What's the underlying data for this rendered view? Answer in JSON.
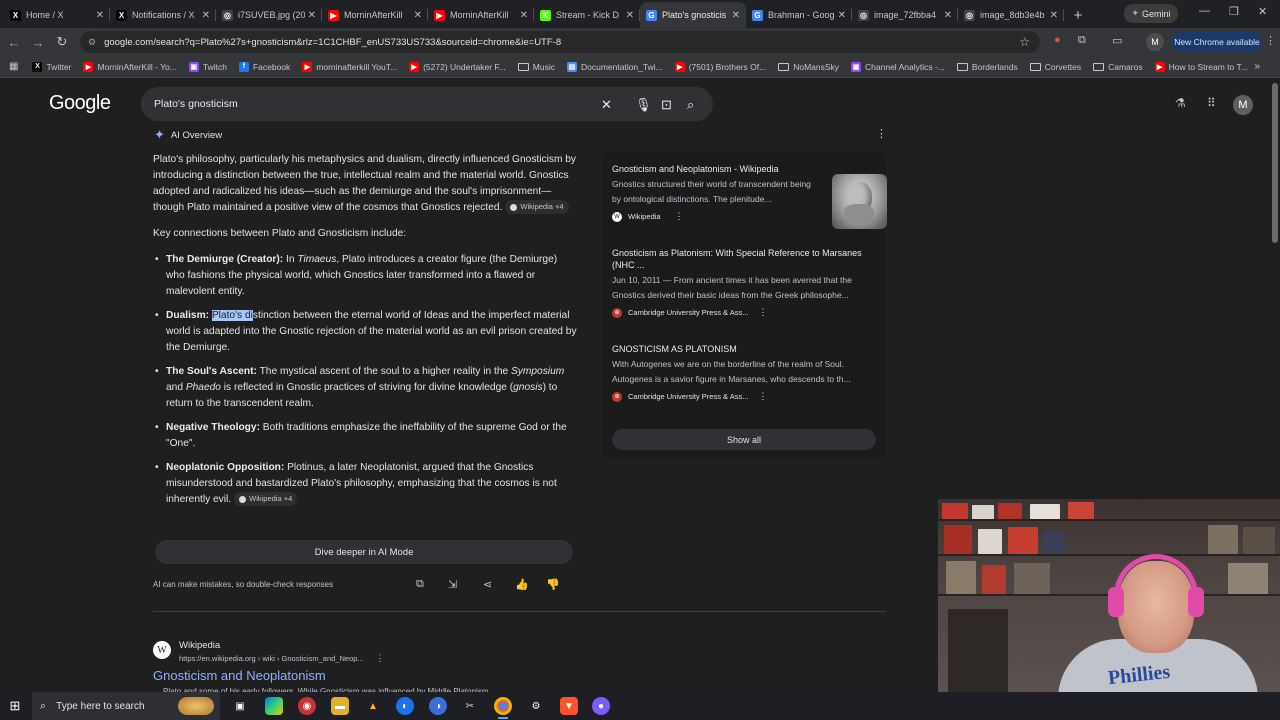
{
  "tabs": [
    {
      "title": "Home / X",
      "fav": "X",
      "color": "#000000"
    },
    {
      "title": "Notifications / X",
      "fav": "X",
      "color": "#000000"
    },
    {
      "title": "i7SUVEB.jpg (20",
      "fav": "◎",
      "color": "#444444"
    },
    {
      "title": "MorninAfterKill",
      "fav": "▶",
      "color": "#ff0000"
    },
    {
      "title": "MorninAfterKill",
      "fav": "▶",
      "color": "#ff0000"
    },
    {
      "title": "Stream - Kick D",
      "fav": "K",
      "color": "#53fc18"
    },
    {
      "title": "Plato's gnosticis",
      "fav": "G",
      "color": "#4285f4",
      "active": true
    },
    {
      "title": "Brahman - Goog",
      "fav": "G",
      "color": "#4285f4"
    },
    {
      "title": "image_72fbba4",
      "fav": "◎",
      "color": "#444444"
    },
    {
      "title": "image_8db3e4b",
      "fav": "◎",
      "color": "#444444"
    }
  ],
  "browser": {
    "gemini": "Gemini",
    "url": "google.com/search?q=Plato%27s+gnosticism&rlz=1C1CHBF_enUS733US733&sourceid=chrome&ie=UTF-8",
    "new_chrome": "New Chrome available",
    "profile_letter": "M"
  },
  "bookmarks": [
    {
      "label": "Twitter",
      "kind": "x"
    },
    {
      "label": "MorninAfterKill - Yo...",
      "kind": "yt"
    },
    {
      "label": "Twitch",
      "kind": "tw"
    },
    {
      "label": "Facebook",
      "kind": "fb"
    },
    {
      "label": "morninafterkill YouT...",
      "kind": "yt"
    },
    {
      "label": "(5272) Undertaker F...",
      "kind": "yt"
    },
    {
      "label": "Music",
      "kind": "folder"
    },
    {
      "label": "Documentation_Twi...",
      "kind": "doc"
    },
    {
      "label": "(7501) Brothers Of...",
      "kind": "yt"
    },
    {
      "label": "NoMansSky",
      "kind": "folder"
    },
    {
      "label": "Channel Analytics -...",
      "kind": "tw"
    },
    {
      "label": "Borderlands",
      "kind": "folder"
    },
    {
      "label": "Corvettes",
      "kind": "folder"
    },
    {
      "label": "Camaros",
      "kind": "folder"
    },
    {
      "label": "How to Stream to T...",
      "kind": "yt"
    }
  ],
  "google": {
    "logo": "Google",
    "query": "Plato's gnosticism",
    "avatar": "M"
  },
  "aio": {
    "header": "AI Overview",
    "para1": "Plato's philosophy, particularly his metaphysics and dualism, directly influenced Gnosticism by introducing a distinction between the true, intellectual realm and the material world. Gnostics adopted and radicalized his ideas—such as the demiurge and the soul's imprisonment—though Plato maintained a positive view of the cosmos that Gnostics rejected.",
    "cite": "Wikipedia +4",
    "intro": "Key connections between Plato and Gnosticism include:",
    "b1_title": "The Demiurge (Creator):",
    "b1_a": " In ",
    "b1_em": "Timaeus",
    "b1_b": ", Plato introduces a creator figure (the Demiurge) who fashions the physical world, which Gnostics later transformed into a flawed or malevolent entity.",
    "b2_title": "Dualism:",
    "b2_hl": "Plato's di",
    "b2_rest": "stinction between the eternal world of Ideas and the imperfect material world is adapted into the Gnostic rejection of the material world as an evil prison created by the Demiurge.",
    "b3_title": "The Soul's Ascent:",
    "b3_a": " The mystical ascent of the soul to a higher reality in the ",
    "b3_em1": "Symposium",
    "b3_b": " and ",
    "b3_em2": "Phaedo",
    "b3_c": " is reflected in Gnostic practices of striving for divine knowledge (",
    "b3_em3": "gnosis",
    "b3_d": ") to return to the transcendent realm.",
    "b4_title": "Negative Theology:",
    "b4_text": " Both traditions emphasize the ineffability of the supreme God or the \"One\".",
    "b5_title": "Neoplatonic Opposition:",
    "b5_text": " Plotinus, a later Neoplatonist, argued that the Gnostics misunderstood and bastardized Plato's philosophy, emphasizing that the cosmos is not inherently evil.",
    "cite2": "Wikipedia +4",
    "deeper": "Dive deeper in AI Mode",
    "disclaimer": "AI can make mistakes, so double-check responses"
  },
  "sources": [
    {
      "title": "Gnosticism and Neoplatonism - Wikipedia",
      "snippet": "Gnostics structured their world of transcendent being by ontological distinctions. The plenitude...",
      "publisher": "Wikipedia"
    },
    {
      "title": "Gnosticism as Platonism: With Special Reference to Marsanes (NHC ...",
      "snippet": "Jun 10, 2011 — From ancient times it has been averred that the Gnostics derived their basic ideas from the Greek philosophe...",
      "publisher": "Cambridge University Press & Ass..."
    },
    {
      "title": "GNOSTICISM AS PLATONISM",
      "snippet": "With Autogenes we are on the borderline of the realm of Soul. Autogenes is a savior figure in Marsanes, who descends to th...",
      "publisher": "Cambridge University Press & Ass..."
    }
  ],
  "show_all": "Show all",
  "result": {
    "site": "Wikipedia",
    "url": "https://en.wikipedia.org › wiki › Gnosticism_and_Neop...",
    "title": "Gnosticism and Neoplatonism",
    "snippet": "Plato and some of his early followers. While Gnosticism was influenced by Middle Platonism, ..."
  },
  "taskbar": {
    "search_placeholder": "Type here to search"
  },
  "colors": {
    "accent": "#8ab4f8",
    "page_bg": "#1f1f1f",
    "highlight": "#a8c7fa",
    "headset": "#e04aa8"
  }
}
